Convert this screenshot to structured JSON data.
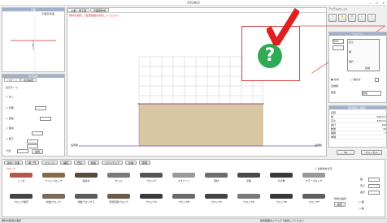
{
  "window": {
    "title": "STORIO",
    "min": "—",
    "max": "☐",
    "close": "✕"
  },
  "left_top_panel": {
    "label_a": "平面",
    "label_b": "平面図/断面",
    "label_c": "ア"
  },
  "left_mid_panel": {
    "header": "表示設定",
    "tabs": [
      "パターン",
      "表示設定"
    ],
    "row1": "表示モード",
    "opt1": "なし",
    "opt2": "石積",
    "opt2_val": "",
    "opt3": "目地",
    "opt3_val": "",
    "opt4": "素材",
    "dim1": "",
    "opt5": "施工",
    "field_a": "",
    "field_b": "",
    "size_label": "寸法",
    "size_val": "",
    "apply": "適用"
  },
  "canvas": {
    "tabs": [
      "立面",
      "施工図",
      "平面図作成"
    ],
    "hint": "部材を選択して配置範囲を指定してください。",
    "left_label": "境界線",
    "right_label": "境界線"
  },
  "help_overlay": {
    "icon": "help-question-icon",
    "label": "?"
  },
  "right_panel": {
    "title": "アイテムパレット",
    "props": {
      "header": "プロパティ",
      "size_a": "500",
      "size_b": "",
      "dims": [
        "高さ",
        "幅",
        "奥行",
        "目地"
      ],
      "radio_a": "方向",
      "radio_b": "積み方",
      "check": "",
      "label_a": "目地幅",
      "label_b": "配置",
      "sel": "通常"
    },
    "info": {
      "header": "部材情報（積算）",
      "rows": [
        [
          "名称",
          ""
        ],
        [
          "幅",
          "400mm"
        ],
        [
          "高さ",
          "200mm"
        ],
        [
          "奥行",
          "100"
        ],
        [
          "数量",
          "26"
        ],
        [
          "面積",
          "7"
        ],
        [
          "単価",
          ""
        ]
      ]
    },
    "btn_a": "OK",
    "btn_b": "キャンセル"
  },
  "bottom": {
    "tabs": [
      "建材・平面",
      "塀・門",
      "フェンス",
      "舗装",
      "門扉",
      "植栽",
      "エクステリア",
      "外構",
      "照明"
    ],
    "cat": "ブロック",
    "check_label": "全素材を表示",
    "materials": [
      {
        "name": "レンガ",
        "color": "#b5564a"
      },
      {
        "name": "ウッドブロック",
        "color": "#8a6a45"
      },
      {
        "name": "強化木",
        "color": "#5a4a3a"
      },
      {
        "name": "タイル",
        "color": "#7a7a7a"
      },
      {
        "name": "ブロック",
        "color": "#555555"
      },
      {
        "name": "スクリーン",
        "color": "#9a9a9a"
      },
      {
        "name": "床材",
        "color": "#6c6c6c"
      },
      {
        "name": "平板",
        "color": "#4a4a4a"
      },
      {
        "name": "その他",
        "color": "#3a3a3a"
      },
      {
        "name": "カラーブロック",
        "color": "#999999"
      },
      {
        "name": "ブロック長尺",
        "color": "#444444"
      },
      {
        "name": "化粧ブロック",
        "color": "#7a6a5a"
      },
      {
        "name": "化粧ブロック２",
        "color": "#5a5a5a"
      },
      {
        "name": "天然石調ブロック",
        "color": "#6a5a4a"
      },
      {
        "name": "ブロックA",
        "color": "#3a3a3a"
      },
      {
        "name": "ブロックB",
        "color": "#6a6a6a"
      },
      {
        "name": "ブロックC",
        "color": "#454545"
      },
      {
        "name": "ブロックD",
        "color": "#777777"
      },
      {
        "name": "ブロックE",
        "color": "#383838"
      },
      {
        "name": "ブロックF",
        "color": "#5f5f5f"
      }
    ],
    "side": {
      "lbl_a": "幅",
      "val_a": "",
      "lbl_b": "高さ",
      "val_b": "",
      "lbl_c": "奥行",
      "val_c": "",
      "lbl_d": "目地の設定",
      "btn": "設定",
      "opt_a": "横",
      "opt_b": "縦"
    },
    "status_left": "部材の配置を選択",
    "status_right": "配置範囲をドラッグで指定してください"
  },
  "colors": {
    "wall": "#d9c6a3",
    "grid": "#bbbbbb",
    "accent": "#e02020",
    "help": "#2faa55",
    "header": "#9fb1cc"
  }
}
